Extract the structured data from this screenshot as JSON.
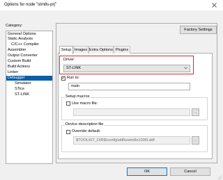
{
  "window": {
    "title": "Options for node \"stm8s-prj\"",
    "close_glyph": "✕"
  },
  "sidebar": {
    "label": "Category:",
    "items": [
      {
        "label": "General Options",
        "level": 1,
        "selected": false
      },
      {
        "label": "Static Analysis",
        "level": 1,
        "selected": false
      },
      {
        "label": "C/C++ Compiler",
        "level": 2,
        "selected": false
      },
      {
        "label": "Assembler",
        "level": 2,
        "selected": false
      },
      {
        "label": "Output Converter",
        "level": 2,
        "selected": false
      },
      {
        "label": "Custom Build",
        "level": 2,
        "selected": false
      },
      {
        "label": "Build Actions",
        "level": 2,
        "selected": false
      },
      {
        "label": "Linker",
        "level": 2,
        "selected": false
      },
      {
        "label": "Debugger",
        "level": 2,
        "selected": true
      },
      {
        "label": "Simulator",
        "level": 3,
        "selected": false
      },
      {
        "label": "STice",
        "level": 3,
        "selected": false
      },
      {
        "label": "ST-LINK",
        "level": 3,
        "selected": false
      }
    ]
  },
  "toolbar": {
    "factory_settings_label": "Factory Settings"
  },
  "tabs": [
    {
      "label": "Setup",
      "active": true
    },
    {
      "label": "Images",
      "active": false
    },
    {
      "label": "Extra Options",
      "active": false
    },
    {
      "label": "Plugins",
      "active": false
    }
  ],
  "setup": {
    "driver_label": "Driver:",
    "driver_value": "ST-LINK",
    "run_to_label": "Run to:",
    "run_to_checked": true,
    "run_to_value": "main",
    "setup_macros_title": "Setup macros",
    "use_macro_label": "Use macro file:",
    "use_macro_checked": false,
    "macro_file_value": "",
    "device_desc_title": "Device description file",
    "override_label": "Override default:",
    "override_checked": false,
    "device_desc_value": "$TOOLKIT_DIR$\\config\\ddf\\iostm8s103f3.ddf",
    "browse_label": "..."
  },
  "footer": {
    "ok_label": "OK",
    "cancel_label": "Cancel"
  },
  "colors": {
    "selection": "#0a5ea8",
    "highlight_border": "#e0232b",
    "default_button_border": "#0078d7"
  }
}
